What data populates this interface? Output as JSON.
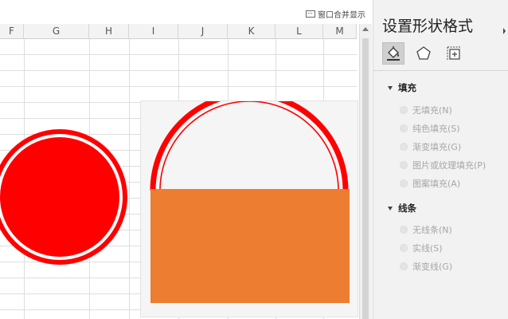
{
  "toolbar": {
    "merge_label": "窗口合并显示"
  },
  "sheet": {
    "columns": [
      "F",
      "G",
      "H",
      "I",
      "J",
      "K",
      "L",
      "M"
    ]
  },
  "pane": {
    "title": "设置形状格式",
    "tabs": [
      {
        "name": "fill-line-icon",
        "active": true
      },
      {
        "name": "effects-pentagon-icon",
        "active": false
      },
      {
        "name": "size-properties-icon",
        "active": false
      }
    ],
    "fill_section": {
      "label": "填充",
      "options": [
        "无填充(N)",
        "纯色填充(S)",
        "渐变填充(G)",
        "图片或纹理填充(P)",
        "图案填充(A)"
      ]
    },
    "line_section": {
      "label": "线条",
      "options": [
        "无线条(N)",
        "实线(S)",
        "渐变线(G)"
      ]
    }
  },
  "colors": {
    "red": "#ff0000",
    "orange": "#ed7d31",
    "accent_green": "#217346"
  }
}
